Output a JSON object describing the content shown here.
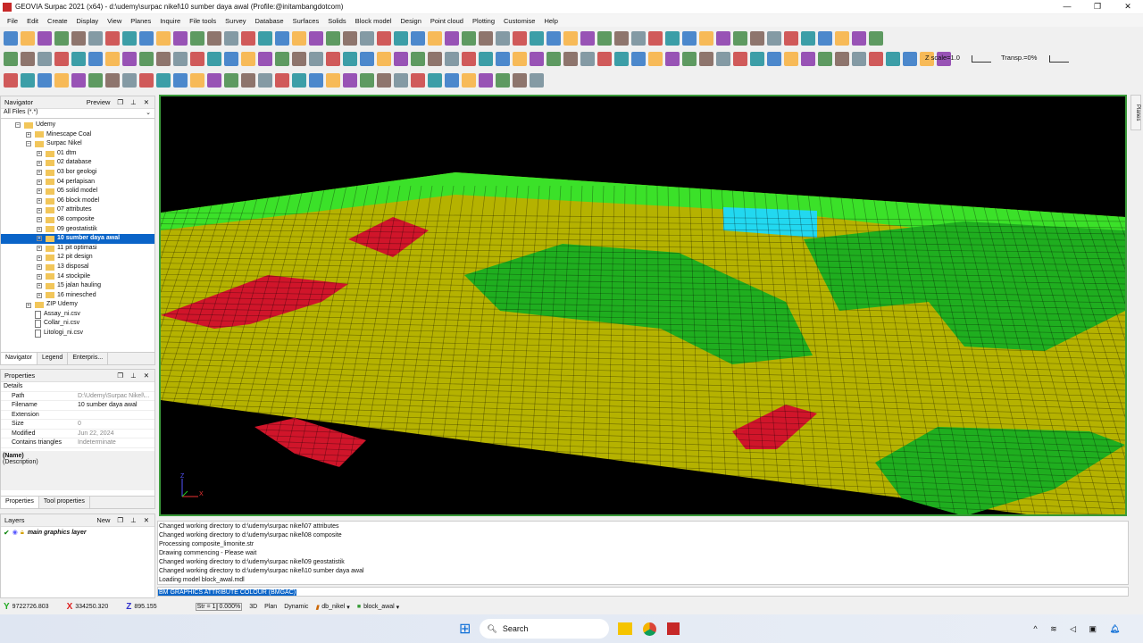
{
  "window": {
    "title": "GEOVIA Surpac 2021 (x64) - d:\\udemy\\surpac nikel\\10 sumber daya awal (Profile:@initambangdotcom)",
    "controls": [
      "—",
      "❐",
      "✕"
    ]
  },
  "menu": [
    "File",
    "Edit",
    "Create",
    "Display",
    "View",
    "Planes",
    "Inquire",
    "File tools",
    "Survey",
    "Database",
    "Surfaces",
    "Solids",
    "Block model",
    "Design",
    "Point cloud",
    "Plotting",
    "Customise",
    "Help"
  ],
  "toolbar": {
    "zscale": "Z scale=1.0",
    "transp": "Transp.=0%",
    "zscale_value": 1.0,
    "transp_value": 0
  },
  "navigator": {
    "title": "Navigator",
    "preview": "Preview",
    "filter": "All Files (*.*)",
    "tree": [
      {
        "label": "Udemy",
        "level": 1,
        "type": "folder",
        "exp": "-"
      },
      {
        "label": "Minescape Coal",
        "level": 2,
        "type": "folder",
        "exp": "+"
      },
      {
        "label": "Surpac Nikel",
        "level": 2,
        "type": "folder",
        "exp": "-"
      },
      {
        "label": "01 dtm",
        "level": 3,
        "type": "folder",
        "exp": "+"
      },
      {
        "label": "02 database",
        "level": 3,
        "type": "folder",
        "exp": "+"
      },
      {
        "label": "03 bor geologi",
        "level": 3,
        "type": "folder",
        "exp": "+"
      },
      {
        "label": "04 perlapisan",
        "level": 3,
        "type": "folder",
        "exp": "+"
      },
      {
        "label": "05 solid model",
        "level": 3,
        "type": "folder",
        "exp": "+"
      },
      {
        "label": "06 block model",
        "level": 3,
        "type": "folder",
        "exp": "+"
      },
      {
        "label": "07 attributes",
        "level": 3,
        "type": "folder",
        "exp": "+"
      },
      {
        "label": "08 composite",
        "level": 3,
        "type": "folder",
        "exp": "+"
      },
      {
        "label": "09 geostatistik",
        "level": 3,
        "type": "folder",
        "exp": "+"
      },
      {
        "label": "10 sumber daya awal",
        "level": 3,
        "type": "folder",
        "exp": "+",
        "selected": true
      },
      {
        "label": "11 pit optimasi",
        "level": 3,
        "type": "folder",
        "exp": "+"
      },
      {
        "label": "12 pit design",
        "level": 3,
        "type": "folder",
        "exp": "+"
      },
      {
        "label": "13 disposal",
        "level": 3,
        "type": "folder",
        "exp": "+"
      },
      {
        "label": "14 stockpile",
        "level": 3,
        "type": "folder",
        "exp": "+"
      },
      {
        "label": "15 jalan hauling",
        "level": 3,
        "type": "folder",
        "exp": "+"
      },
      {
        "label": "16 minesched",
        "level": 3,
        "type": "folder",
        "exp": "+"
      },
      {
        "label": "ZIP Udemy",
        "level": 2,
        "type": "folder",
        "exp": "+"
      },
      {
        "label": "Assay_ni.csv",
        "level": 2,
        "type": "file"
      },
      {
        "label": "Collar_ni.csv",
        "level": 2,
        "type": "file"
      },
      {
        "label": "Litologi_ni.csv",
        "level": 2,
        "type": "file"
      }
    ],
    "tabs": [
      "Navigator",
      "Legend",
      "Enterpris..."
    ]
  },
  "properties": {
    "title": "Properties",
    "section": "Details",
    "rows": [
      {
        "k": "Path",
        "v": "D:\\Udemy\\Surpac Nikel\\..."
      },
      {
        "k": "Filename",
        "v": "10 sumber daya awal"
      },
      {
        "k": "Extension",
        "v": ""
      },
      {
        "k": "Size",
        "v": "0"
      },
      {
        "k": "Modified",
        "v": "Jun 22, 2024"
      },
      {
        "k": "Contains triangles",
        "v": "Indeterminate"
      }
    ],
    "name": "(Name)",
    "description": "(Description)",
    "tabs": [
      "Properties",
      "Tool properties"
    ]
  },
  "layers": {
    "title": "Layers",
    "new": "New",
    "items": [
      "main graphics layer"
    ]
  },
  "side_tab": "Planes",
  "viewport": {
    "colors": {
      "background": "#000000",
      "low": "#b5b200",
      "mid": "#1fae1f",
      "high": "#2ee62e",
      "red": "#d0152a",
      "cyan": "#22d8f0"
    },
    "axis": [
      "Z",
      "X"
    ]
  },
  "console": [
    "Changed working directory to d:\\udemy\\surpac nikel\\07 attributes",
    "Changed working directory to d:\\udemy\\surpac nikel\\08 composite",
    "Processing composite_limonite.str",
    "Drawing commencing - Please wait",
    "Changed working directory to d:\\udemy\\surpac nikel\\09 geostatistik",
    "Changed working directory to d:\\udemy\\surpac nikel\\10 sumber daya awal",
    "Loading model block_awal.mdl"
  ],
  "command": "BM GRAPHICS ATTRIBUTE COLOUR (BMGAC)",
  "status": {
    "y": "9722726.803",
    "x": "334250.320",
    "z": "895.155",
    "str": "Str = 1",
    "pct": "0.000%",
    "mode3d": "3D",
    "plan": "Plan",
    "dynamic": "Dynamic",
    "db": "db_nikel",
    "model": "block_awal"
  },
  "taskbar": {
    "search": "Search"
  }
}
